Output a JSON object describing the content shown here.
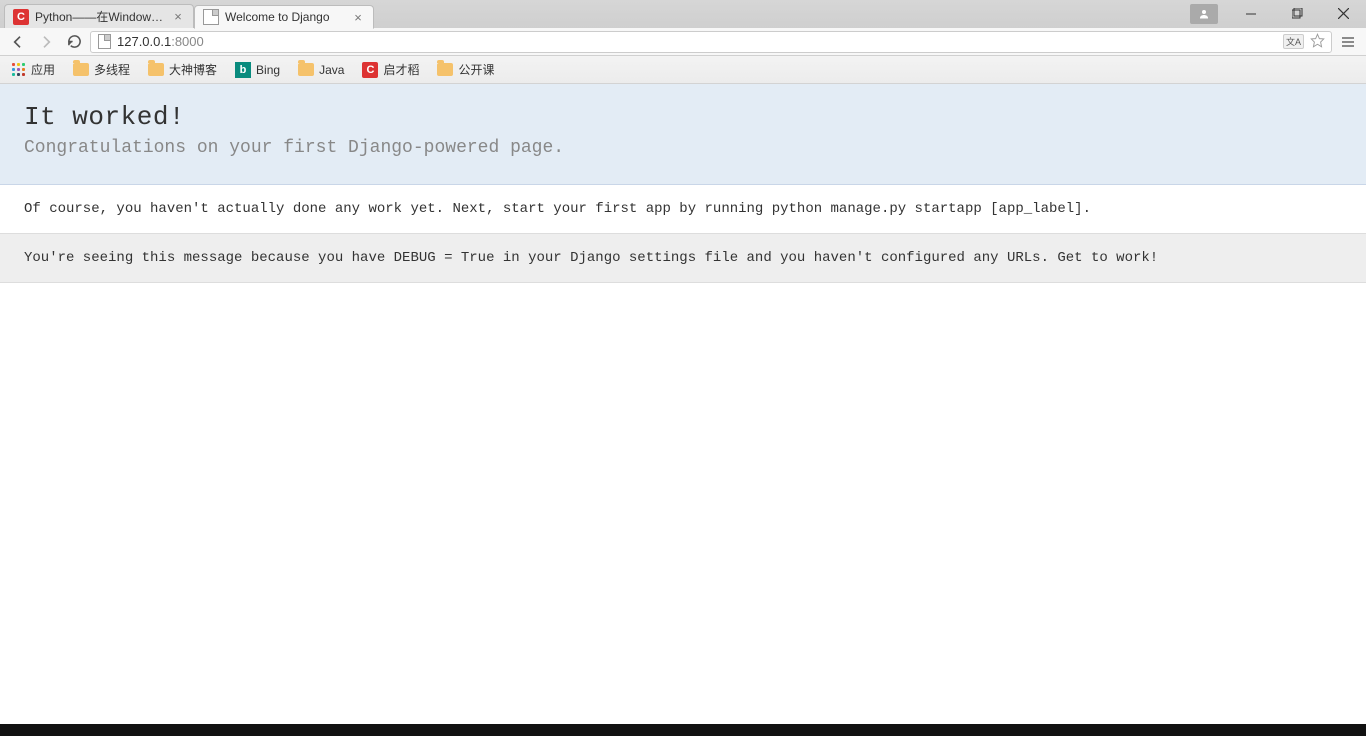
{
  "tabs": [
    {
      "title": "Python——在Windows下",
      "active": false,
      "favicon": "c"
    },
    {
      "title": "Welcome to Django",
      "active": true,
      "favicon": "page"
    }
  ],
  "address_bar": {
    "host": "127.0.0.1",
    "port": ":8000"
  },
  "apps_label": "应用",
  "bookmarks": [
    {
      "icon": "folder",
      "label": "多线程"
    },
    {
      "icon": "folder",
      "label": "大神博客"
    },
    {
      "icon": "bing",
      "label": "Bing"
    },
    {
      "icon": "folder",
      "label": "Java"
    },
    {
      "icon": "c",
      "label": "启才稻"
    },
    {
      "icon": "folder",
      "label": "公开课"
    }
  ],
  "page": {
    "heading": "It worked!",
    "subheading": "Congratulations on your first Django-powered page.",
    "instructions": "Of course, you haven't actually done any work yet. Next, start your first app by running python manage.py startapp [app_label].",
    "explanation": "You're seeing this message because you have DEBUG = True in your Django settings file and you haven't configured any URLs. Get to work!"
  }
}
